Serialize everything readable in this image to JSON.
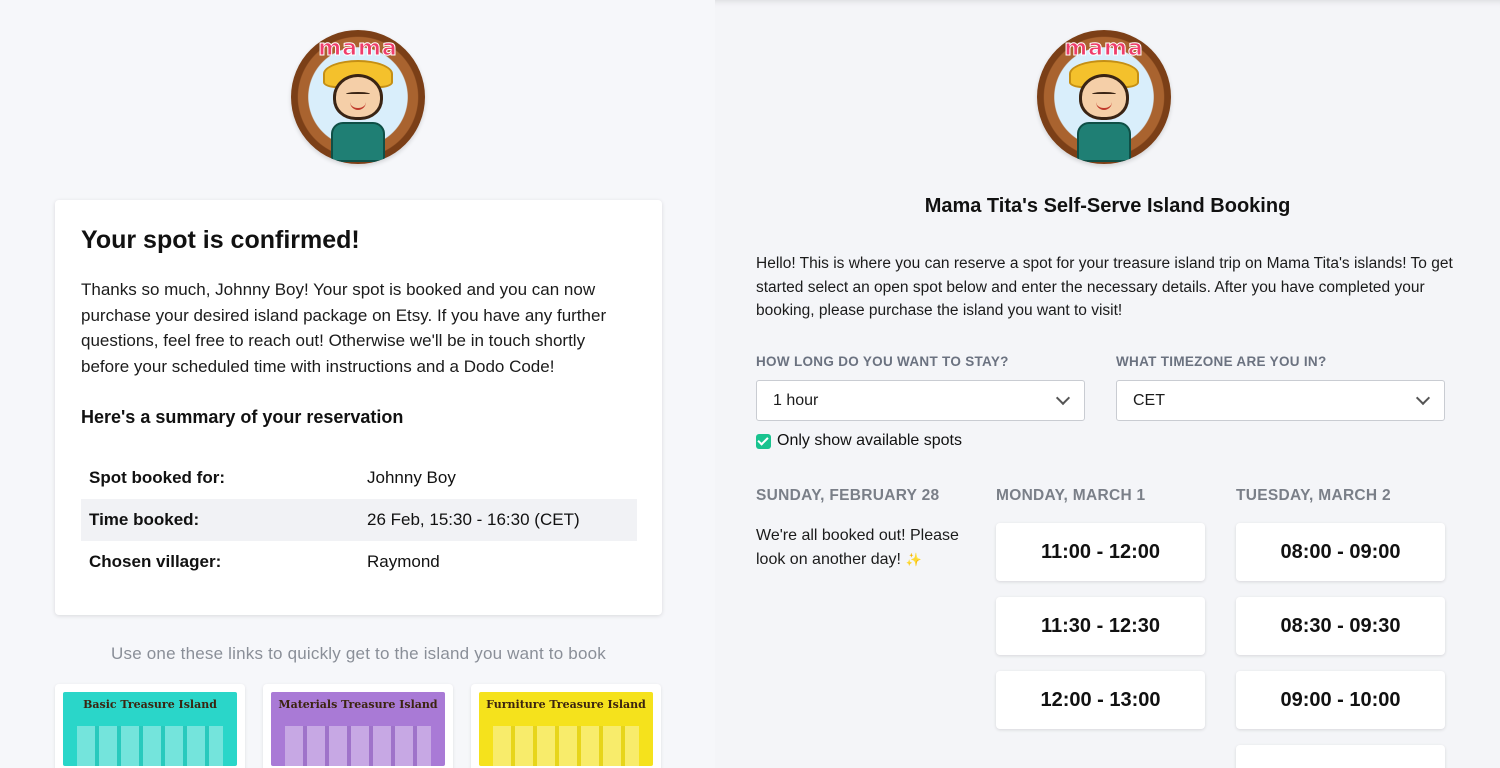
{
  "left": {
    "logo_text": "mama tita",
    "card": {
      "title": "Your spot is confirmed!",
      "message": "Thanks so much, Johnny Boy! Your spot is booked and you can now purchase your desired island package on Etsy. If you have any further questions, feel free to reach out! Otherwise we'll be in touch shortly before your scheduled time with instructions and a Dodo Code!",
      "summary_heading": "Here's a summary of your reservation",
      "summary": [
        {
          "label": "Spot booked for:",
          "value": "Johnny Boy"
        },
        {
          "label": "Time booked:",
          "value": "26 Feb, 15:30 - 16:30 (CET)"
        },
        {
          "label": "Chosen villager:",
          "value": "Raymond"
        }
      ]
    },
    "hint": "Use one these links to quickly get to the island you want to book",
    "islands": [
      {
        "title": "Basic Treasure Island",
        "color": "#2ad6c9"
      },
      {
        "title": "Materials Treasure Island",
        "color": "#a97ad6"
      },
      {
        "title": "Furniture Treasure Island",
        "color": "#f5e21c"
      }
    ]
  },
  "right": {
    "logo_text": "mama tita",
    "title": "Mama Tita's Self-Serve Island Booking",
    "intro": "Hello! This is where you can reserve a spot for your treasure island trip on Mama Tita's islands! To get started select an open spot below and enter the necessary details. After you have completed your booking, please purchase the island you want to visit!",
    "stay_label": "HOW LONG DO YOU WANT TO STAY?",
    "stay_value": "1 hour",
    "tz_label": "WHAT TIMEZONE ARE YOU IN?",
    "tz_value": "CET",
    "available_only_label": "Only show available spots",
    "available_only_checked": true,
    "days": [
      {
        "name": "SUNDAY, FEBRUARY 28",
        "message": "We're all booked out! Please look on another day!",
        "slots": []
      },
      {
        "name": "MONDAY, MARCH 1",
        "slots": [
          "11:00 - 12:00",
          "11:30 - 12:30",
          "12:00 - 13:00"
        ]
      },
      {
        "name": "TUESDAY, MARCH 2",
        "slots": [
          "08:00 - 09:00",
          "08:30 - 09:30",
          "09:00 - 10:00"
        ]
      }
    ],
    "accent_color": "#19c38f"
  }
}
